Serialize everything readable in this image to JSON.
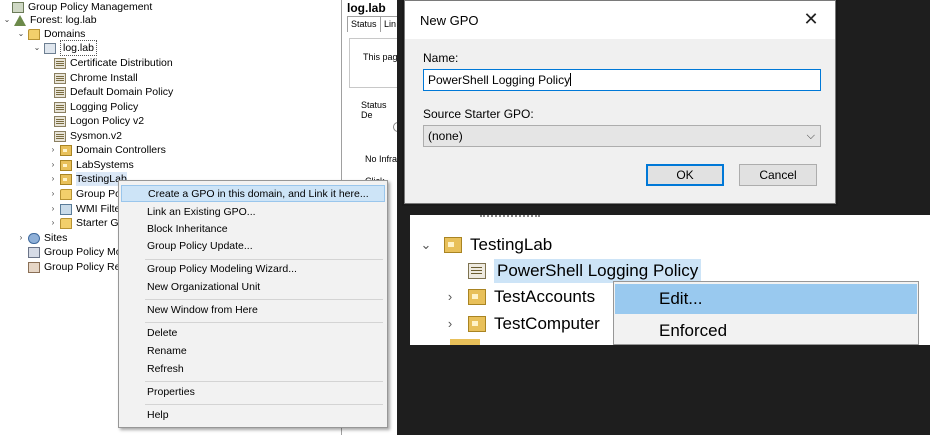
{
  "gpmc": {
    "tree": {
      "root": "Group Policy Management",
      "forest": "Forest: log.lab",
      "domains": "Domains",
      "domain": "log.lab",
      "gpos": [
        "Certificate Distribution",
        "Chrome Install",
        "Default Domain Policy",
        "Logging Policy",
        "Logon Policy v2",
        "Sysmon.v2"
      ],
      "ous": [
        "Domain Controllers",
        "LabSystems",
        "TestingLab"
      ],
      "group_policy_objects_partial": "Group Po",
      "wmi_filters_partial": "WMI Filte",
      "starter_gpos_partial": "Starter Gl",
      "sites": "Sites",
      "modeling_partial": "Group Policy Mo",
      "results_partial": "Group Policy Re"
    },
    "right_pane": {
      "title": "log.lab",
      "tab_status": "Status",
      "tab_linked_partial": "Lin",
      "text1": "This pag",
      "text2": "Status De",
      "text3": "No Infra",
      "text4": "Click the"
    },
    "context_menu": [
      "Create a GPO in this domain, and Link it here...",
      "Link an Existing GPO...",
      "Block Inheritance",
      "Group Policy Update...",
      "Group Policy Modeling Wizard...",
      "New Organizational Unit",
      "New Window from Here",
      "Delete",
      "Rename",
      "Refresh",
      "Properties",
      "Help"
    ]
  },
  "dialog": {
    "title": "New GPO",
    "close_glyph": "✕",
    "name_label": "Name:",
    "name_value": "PowerShell Logging Policy",
    "starter_label": "Source Starter GPO:",
    "starter_value": "(none)",
    "ok": "OK",
    "cancel": "Cancel"
  },
  "zoom": {
    "ou": "TestingLab",
    "new_gpo": "PowerShell Logging Policy",
    "children": [
      "TestAccounts",
      "TestComputer"
    ],
    "menu": [
      "Edit...",
      "Enforced"
    ]
  }
}
